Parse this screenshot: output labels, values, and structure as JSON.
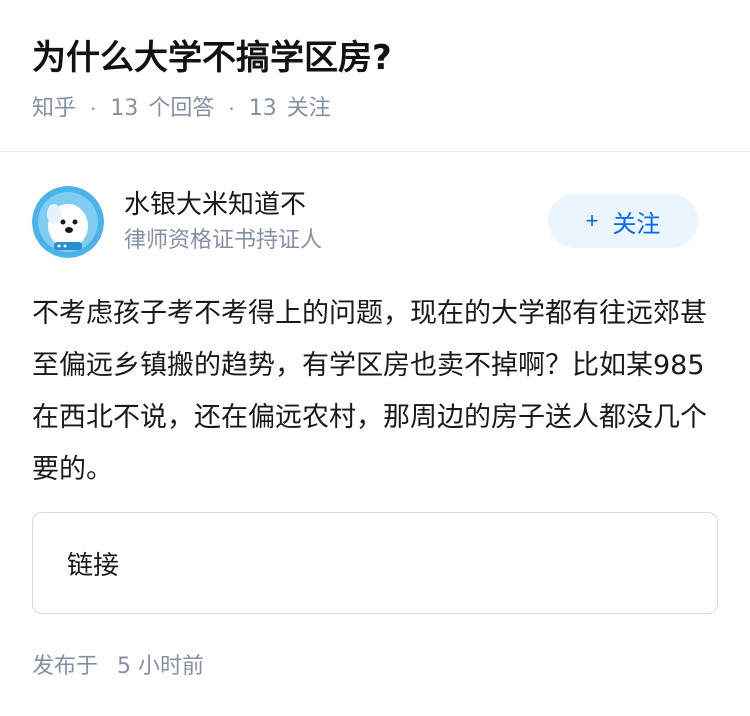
{
  "question": {
    "title": "为什么大学不搞学区房?",
    "source": "知乎",
    "answers_count": "13",
    "answers_label": "个回答",
    "followers_count": "13",
    "followers_label": "关注",
    "separator": "·"
  },
  "author": {
    "name": "水银大米知道不",
    "badge": "律师资格证书持证人",
    "avatar_icon": "cartoon-dog-avatar",
    "follow_plus": "+",
    "follow_label": "关注"
  },
  "answer": {
    "text": "不考虑孩子考不考得上的问题，现在的大学都有往远郊甚至偏远乡镇搬的趋势，有学区房也卖不掉啊？比如某985在西北不说，还在偏远农村，那周边的房子送人都没几个要的。"
  },
  "link_card": {
    "label": "链接"
  },
  "publish": {
    "prefix": "发布于",
    "time": "5 小时前"
  },
  "colors": {
    "accent": "#0066ff",
    "follow_bg": "#ebf5fd",
    "meta": "#8590a6",
    "avatar_bg": "#4ab3ea"
  }
}
